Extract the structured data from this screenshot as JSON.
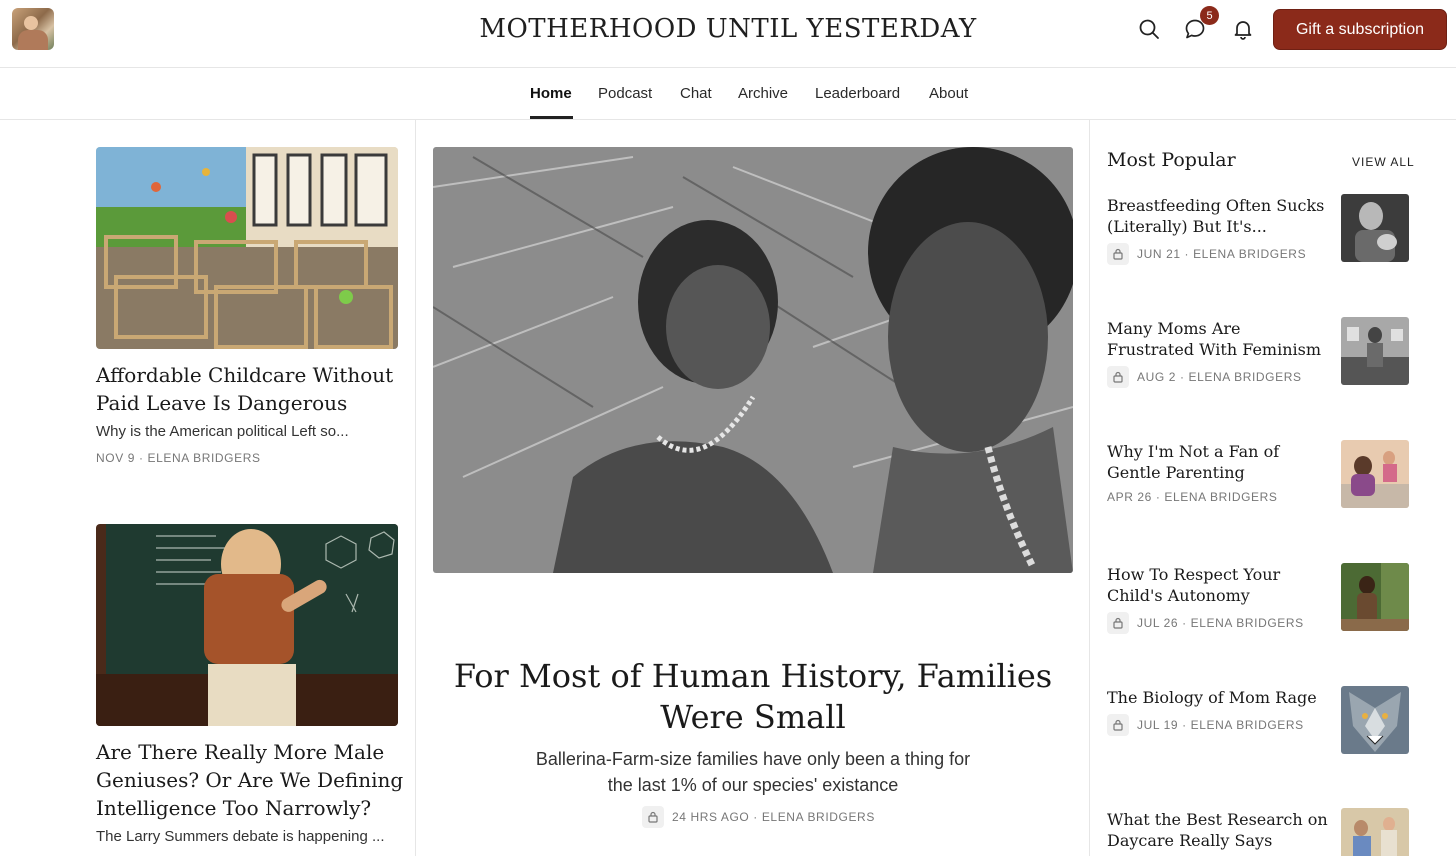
{
  "header": {
    "site_title": "MOTHERHOOD UNTIL YESTERDAY",
    "notification_count": "5",
    "gift_label": "Gift a subscription",
    "accent_color": "#8b2a1a"
  },
  "nav": {
    "items": [
      "Home",
      "Podcast",
      "Chat",
      "Archive",
      "Leaderboard",
      "About"
    ],
    "active": "Home"
  },
  "left_posts": [
    {
      "title": "Affordable Childcare Without Paid Leave Is Dangerous",
      "subtitle": "Why is the American political Left so...",
      "meta": "NOV 9 · ELENA BRIDGERS"
    },
    {
      "title": "Are There Really More Male Geniuses? Or Are We Defining Intelligence Too Narrowly?",
      "subtitle": "The Larry Summers debate is happening ..."
    }
  ],
  "featured": {
    "title": "For Most of Human History, Families Were Small",
    "subtitle": "Ballerina-Farm-size families have only been a thing for the last 1% of our species' existance",
    "meta": "24 HRS AGO · ELENA BRIDGERS"
  },
  "most_popular": {
    "heading": "Most Popular",
    "view_all": "VIEW ALL",
    "items": [
      {
        "title": "Breastfeeding Often Sucks (Literally) But It's...",
        "meta": "JUN 21 · ELENA BRIDGERS",
        "locked": true
      },
      {
        "title": "Many Moms Are Frustrated With Feminism",
        "meta": "AUG 2 · ELENA BRIDGERS",
        "locked": true
      },
      {
        "title": "Why I'm Not a Fan of Gentle Parenting",
        "meta": "APR 26 · ELENA BRIDGERS",
        "locked": false
      },
      {
        "title": "How To Respect Your Child's Autonomy",
        "meta": "JUL 26 · ELENA BRIDGERS",
        "locked": true
      },
      {
        "title": "The Biology of Mom Rage",
        "meta": "JUL 19 · ELENA BRIDGERS",
        "locked": true
      },
      {
        "title": "What the Best Research on Daycare Really Says"
      }
    ]
  }
}
